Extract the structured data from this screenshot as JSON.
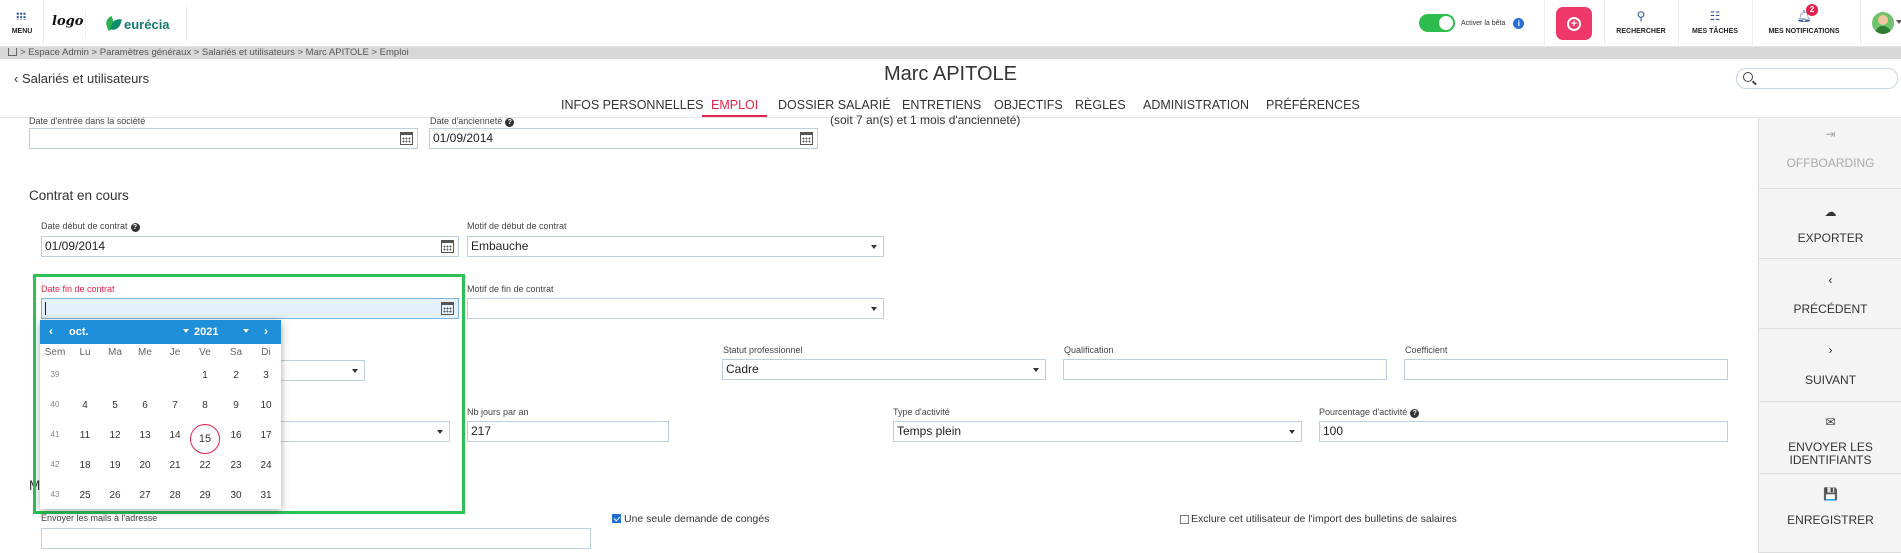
{
  "topbar": {
    "menu_label": "MENU",
    "logo_text": "logo",
    "brand_name": "eurécia",
    "beta_label": "Activer la bêta",
    "search_label": "RECHERCHER",
    "tasks_label": "MES TÂCHES",
    "notifications_label": "MES NOTIFICATIONS",
    "notifications_count": "2"
  },
  "breadcrumb": "> Espace Admin > Paramètres généraux > Salariés et utilisateurs > Marc APITOLE > Emploi",
  "header": {
    "back_label": "Salariés et utilisateurs",
    "title": "Marc APITOLE"
  },
  "tabs": [
    {
      "label": "INFOS PERSONNELLES"
    },
    {
      "label": "EMPLOI"
    },
    {
      "label": "DOSSIER SALARIÉ"
    },
    {
      "label": "ENTRETIENS"
    },
    {
      "label": "OBJECTIFS"
    },
    {
      "label": "RÈGLES"
    },
    {
      "label": "ADMINISTRATION"
    },
    {
      "label": "PRÉFÉRENCES"
    }
  ],
  "form": {
    "entry_date_label": "Date d'entrée dans la société",
    "entry_date_value": "",
    "seniority_date_label": "Date d'ancienneté",
    "seniority_date_value": "01/09/2014",
    "seniority_note": "(soit 7 an(s) et 1 mois d'ancienneté)",
    "contract_section": "Contrat en cours",
    "contract_start_label": "Date début de contrat",
    "contract_start_value": "01/09/2014",
    "contract_start_reason_label": "Motif de début de contrat",
    "contract_start_reason_value": "Embauche",
    "contract_end_label": "Date fin de contrat",
    "contract_end_value": "",
    "contract_end_reason_label": "Motif de fin de contrat",
    "contract_end_reason_value": "",
    "status_label": "Statut professionnel",
    "status_value": "Cadre",
    "qualification_label": "Qualification",
    "qualification_value": "",
    "coefficient_label": "Coefficient",
    "coefficient_value": "",
    "days_per_year_label": "Nb jours par an",
    "days_per_year_value": "217",
    "activity_type_label": "Type d'activité",
    "activity_type_value": "Temps plein",
    "activity_pct_label": "Pourcentage d'activité",
    "activity_pct_value": "100",
    "section_m": "M",
    "mail_label": "Envoyer les mails à l'adresse",
    "mail_value": "",
    "single_leave_label": "Une seule demande de congés",
    "single_leave_checked": true,
    "exclude_import_label": "Exclure cet utilisateur de l'import des bulletins de salaires",
    "exclude_import_checked": false
  },
  "datepicker": {
    "month": "oct.",
    "year": "2021",
    "prev": "‹",
    "next": "›",
    "weekday_headers": [
      "Sem",
      "Lu",
      "Ma",
      "Me",
      "Je",
      "Ve",
      "Sa",
      "Di"
    ],
    "weeks": [
      {
        "week": "39",
        "days": [
          "",
          "",
          "",
          "",
          "1",
          "2",
          "3"
        ]
      },
      {
        "week": "40",
        "days": [
          "4",
          "5",
          "6",
          "7",
          "8",
          "9",
          "10"
        ]
      },
      {
        "week": "41",
        "days": [
          "11",
          "12",
          "13",
          "14",
          "15",
          "16",
          "17"
        ]
      },
      {
        "week": "42",
        "days": [
          "18",
          "19",
          "20",
          "21",
          "22",
          "23",
          "24"
        ]
      },
      {
        "week": "43",
        "days": [
          "25",
          "26",
          "27",
          "28",
          "29",
          "30",
          "31"
        ]
      }
    ],
    "today": "15"
  },
  "actions": [
    {
      "icon": "offboarding-icon",
      "glyph": "⇥",
      "label": "OFFBOARDING",
      "disabled": true
    },
    {
      "icon": "cloud-download-icon",
      "glyph": "☁",
      "label": "EXPORTER",
      "disabled": false
    },
    {
      "icon": "chevron-left-icon",
      "glyph": "‹",
      "label": "PRÉCÉDENT",
      "disabled": false
    },
    {
      "icon": "chevron-right-icon",
      "glyph": "›",
      "label": "SUIVANT",
      "disabled": false
    },
    {
      "icon": "envelope-icon",
      "glyph": "✉",
      "label": "ENVOYER LES IDENTIFIANTS",
      "disabled": false
    },
    {
      "icon": "save-icon",
      "glyph": "💾",
      "label": "ENREGISTRER",
      "disabled": false
    }
  ],
  "colors": {
    "accent": "#e3234a",
    "datepicker_header": "#1e8fd8",
    "highlight": "#2dc155",
    "toggle_on": "#2dbd4e"
  }
}
